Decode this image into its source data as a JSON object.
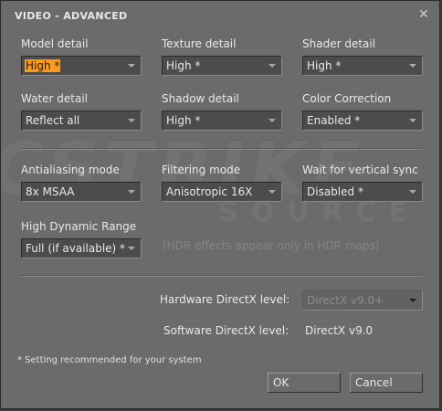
{
  "dialog": {
    "title": "VIDEO - ADVANCED",
    "close_glyph": "✕"
  },
  "watermark": {
    "main": "CSTRIKE",
    "sub": "SOURCE"
  },
  "settings": [
    {
      "label": "Model detail",
      "value": "High *"
    },
    {
      "label": "Texture detail",
      "value": "High *"
    },
    {
      "label": "Shader detail",
      "value": "High *"
    },
    {
      "label": "Water detail",
      "value": "Reflect all"
    },
    {
      "label": "Shadow detail",
      "value": "High *"
    },
    {
      "label": "Color Correction",
      "value": "Enabled *"
    },
    {
      "label": "Antialiasing mode",
      "value": "8x MSAA"
    },
    {
      "label": "Filtering mode",
      "value": "Anisotropic 16X"
    },
    {
      "label": "Wait for vertical sync",
      "value": "Disabled *"
    },
    {
      "label": "High Dynamic Range",
      "value": "Full (if available) *"
    }
  ],
  "hdr_hint": "(HDR effects appear only in HDR maps)",
  "directx": {
    "hardware_label": "Hardware DirectX level:",
    "hardware_value": "DirectX v9.0+",
    "software_label": "Software DirectX level:",
    "software_value": "DirectX v9.0"
  },
  "footnote": "* Setting recommended for your system",
  "buttons": {
    "ok": "OK",
    "cancel": "Cancel"
  },
  "colors": {
    "highlight": "#ff9a1a",
    "panel": "#6b6b6b"
  }
}
